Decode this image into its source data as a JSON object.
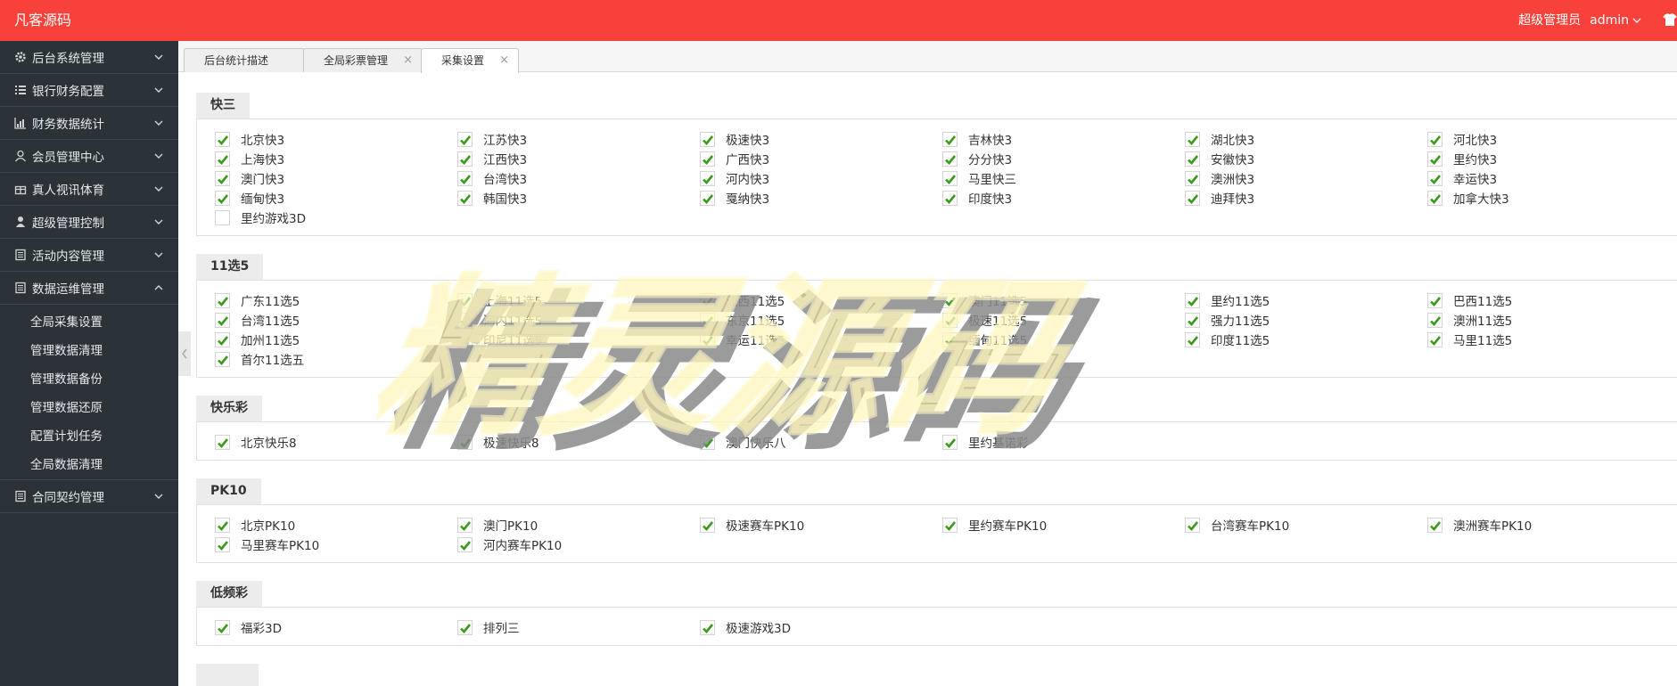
{
  "brand": "凡客源码",
  "user": {
    "role": "超级管理员",
    "name": "admin"
  },
  "sidebar": {
    "items": [
      {
        "label": "后台系统管理",
        "icon": "gear-icon"
      },
      {
        "label": "银行财务配置",
        "icon": "list-icon"
      },
      {
        "label": "财务数据统计",
        "icon": "bar-chart-icon"
      },
      {
        "label": "会员管理中心",
        "icon": "user-outline-icon"
      },
      {
        "label": "真人视讯体育",
        "icon": "gift-icon"
      },
      {
        "label": "超级管理控制",
        "icon": "user-icon"
      },
      {
        "label": "活动内容管理",
        "icon": "book-icon"
      },
      {
        "label": "数据运维管理",
        "icon": "book-icon"
      }
    ],
    "sub_items": [
      "全局采集设置",
      "管理数据清理",
      "管理数据备份",
      "管理数据还原",
      "配置计划任务",
      "全局数据清理"
    ],
    "last_item": {
      "label": "合同契约管理",
      "icon": "book-icon"
    }
  },
  "tabs": [
    {
      "label": "后台统计描述"
    },
    {
      "label": "全局彩票管理"
    },
    {
      "label": "采集设置"
    }
  ],
  "sections": [
    {
      "title": "快三",
      "items": [
        {
          "label": "北京快3",
          "checked": true
        },
        {
          "label": "江苏快3",
          "checked": true
        },
        {
          "label": "极速快3",
          "checked": true
        },
        {
          "label": "吉林快3",
          "checked": true
        },
        {
          "label": "湖北快3",
          "checked": true
        },
        {
          "label": "河北快3",
          "checked": true
        },
        {
          "label": "上海快3",
          "checked": true
        },
        {
          "label": "江西快3",
          "checked": true
        },
        {
          "label": "广西快3",
          "checked": true
        },
        {
          "label": "分分快3",
          "checked": true
        },
        {
          "label": "安徽快3",
          "checked": true
        },
        {
          "label": "里约快3",
          "checked": true
        },
        {
          "label": "澳门快3",
          "checked": true
        },
        {
          "label": "台湾快3",
          "checked": true
        },
        {
          "label": "河内快3",
          "checked": true
        },
        {
          "label": "马里快三",
          "checked": true
        },
        {
          "label": "澳洲快3",
          "checked": true
        },
        {
          "label": "幸运快3",
          "checked": true
        },
        {
          "label": "缅甸快3",
          "checked": true
        },
        {
          "label": "韩国快3",
          "checked": true
        },
        {
          "label": "戛纳快3",
          "checked": true
        },
        {
          "label": "印度快3",
          "checked": true
        },
        {
          "label": "迪拜快3",
          "checked": true
        },
        {
          "label": "加拿大快3",
          "checked": true
        },
        {
          "label": "里约游戏3D",
          "checked": false
        }
      ]
    },
    {
      "title": "11选5",
      "items": [
        {
          "label": "广东11选5",
          "checked": true
        },
        {
          "label": "上海11选5",
          "checked": true
        },
        {
          "label": "江西11选5",
          "checked": true
        },
        {
          "label": "澳门11选5",
          "checked": true
        },
        {
          "label": "里约11选5",
          "checked": true
        },
        {
          "label": "巴西11选5",
          "checked": true
        },
        {
          "label": "台湾11选5",
          "checked": true
        },
        {
          "label": "河内11选5",
          "checked": true
        },
        {
          "label": "东京11选5",
          "checked": true
        },
        {
          "label": "极速11选5",
          "checked": true
        },
        {
          "label": "强力11选5",
          "checked": true
        },
        {
          "label": "澳洲11选5",
          "checked": true
        },
        {
          "label": "加州11选5",
          "checked": true
        },
        {
          "label": "印尼11选5",
          "checked": true
        },
        {
          "label": "幸运11选5",
          "checked": true
        },
        {
          "label": "缅甸11选5",
          "checked": true
        },
        {
          "label": "印度11选5",
          "checked": true
        },
        {
          "label": "马里11选5",
          "checked": true
        },
        {
          "label": "首尔11选五",
          "checked": true
        }
      ]
    },
    {
      "title": "快乐彩",
      "items": [
        {
          "label": "北京快乐8",
          "checked": true
        },
        {
          "label": "极速快乐8",
          "checked": true
        },
        {
          "label": "澳门快乐八",
          "checked": true
        },
        {
          "label": "里约基诺彩",
          "checked": true
        }
      ]
    },
    {
      "title": "PK10",
      "items": [
        {
          "label": "北京PK10",
          "checked": true
        },
        {
          "label": "澳门PK10",
          "checked": true
        },
        {
          "label": "极速赛车PK10",
          "checked": true
        },
        {
          "label": "里约赛车PK10",
          "checked": true
        },
        {
          "label": "台湾赛车PK10",
          "checked": true
        },
        {
          "label": "澳洲赛车PK10",
          "checked": true
        },
        {
          "label": "马里赛车PK10",
          "checked": true
        },
        {
          "label": "河内赛车PK10",
          "checked": true
        }
      ]
    },
    {
      "title": "低频彩",
      "items": [
        {
          "label": "福彩3D",
          "checked": true
        },
        {
          "label": "排列三",
          "checked": true
        },
        {
          "label": "极速游戏3D",
          "checked": true
        }
      ]
    }
  ],
  "watermark": "精灵源码",
  "colors": {
    "topbar": "#f8413a",
    "sidebar": "#2b3338",
    "check": "#3a9a1a"
  }
}
